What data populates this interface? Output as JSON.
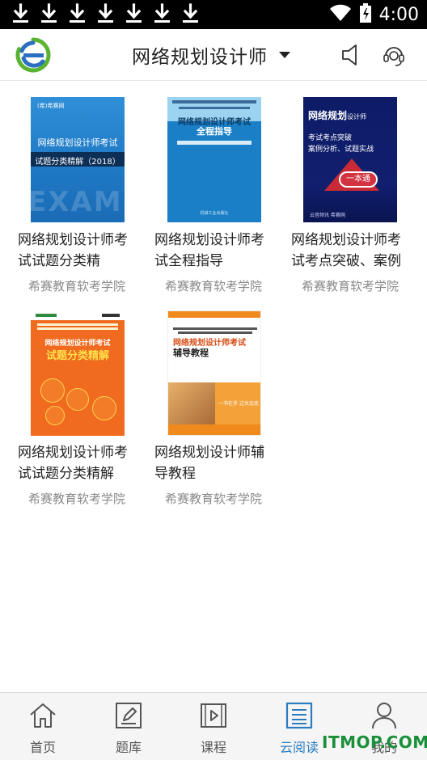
{
  "status_bar": {
    "time": "4:00",
    "download_icons": [
      "download-icon",
      "download-icon",
      "download-icon",
      "download-icon",
      "download-icon",
      "download-icon",
      "download-icon"
    ]
  },
  "header": {
    "title": "网络规划设计师",
    "icons": [
      "app-logo-icon",
      "chevron-down-icon",
      "speaker-icon",
      "customer-service-icon"
    ]
  },
  "books": [
    {
      "title_line1": "网络规划设计师考",
      "title_line2": "试试题分类精",
      "author": "希赛教育软考学院",
      "cover": {
        "brand": "(希)希赛网",
        "line1": "网络规划设计师考试",
        "line2": "试题分类精解（2018）",
        "bg_text": "EXAM"
      }
    },
    {
      "title_line1": "网络规划设计师考",
      "title_line2": "试全程指导",
      "author": "希赛教育软考学院",
      "cover": {
        "line1": "网络规划设计师考试",
        "line2": "全程指导",
        "line3": "机械工业出版社"
      }
    },
    {
      "title_line1": "网络规划设计师考",
      "title_line2": "试考点突破、案例",
      "author": "希赛教育软考学院",
      "cover": {
        "line1": "网络规划",
        "line1_small": "设计师",
        "line2": "考试考点突破",
        "line3": "案例分析、试题实战",
        "badge": "一本通",
        "foot": "云音频讯  希赛网"
      }
    },
    {
      "title_line1": "网络规划设计师考",
      "title_line2": "试试题分类精解",
      "author": "希赛教育软考学院",
      "cover": {
        "line1": "网络规划设计师考试",
        "line2": "试题分类精解"
      }
    },
    {
      "title_line1": "网络规划设计师辅",
      "title_line2": "导教程",
      "author": "希赛教育软考学院",
      "cover": {
        "line1": "网络规划设计师考试",
        "line2": "辅导教程",
        "slogan": "一书在手  过关无忧"
      }
    }
  ],
  "bottom_nav": [
    {
      "label": "首页",
      "icon": "home-icon",
      "active": false
    },
    {
      "label": "题库",
      "icon": "edit-icon",
      "active": false
    },
    {
      "label": "课程",
      "icon": "play-icon",
      "active": false
    },
    {
      "label": "云阅读",
      "icon": "document-list-icon",
      "active": true
    },
    {
      "label": "我的",
      "icon": "user-icon",
      "active": false
    }
  ],
  "watermark": "ITMOP.COM",
  "colors": {
    "accent": "#2a7cc0",
    "status_bar": "#000000",
    "author_text": "#8a8a8a",
    "watermark": "#1a8f3a"
  }
}
